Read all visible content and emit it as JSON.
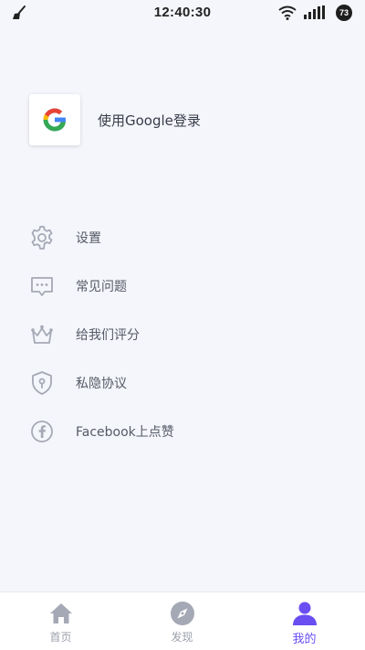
{
  "status_bar": {
    "time": "12:40:30",
    "battery_level": "73",
    "icons": [
      "cleaner-icon",
      "wifi-icon",
      "signal-icon",
      "battery-icon"
    ]
  },
  "login": {
    "label": "使用Google登录",
    "icon": "google-logo-icon"
  },
  "menu": {
    "items": [
      {
        "label": "设置",
        "icon": "gear-icon"
      },
      {
        "label": "常见问题",
        "icon": "chat-bubble-icon"
      },
      {
        "label": "给我们评分",
        "icon": "crown-icon"
      },
      {
        "label": "私隐协议",
        "icon": "shield-lock-icon"
      },
      {
        "label": "Facebook上点赞",
        "icon": "facebook-icon"
      }
    ]
  },
  "tab_bar": {
    "tabs": [
      {
        "label": "首页",
        "icon": "home-icon",
        "active": false
      },
      {
        "label": "发现",
        "icon": "compass-icon",
        "active": false
      },
      {
        "label": "我的",
        "icon": "user-icon",
        "active": true
      }
    ]
  },
  "colors": {
    "background": "#f5f6fb",
    "accent": "#6b4ef2",
    "icon_gray": "#a5a9b5",
    "text": "#555a66"
  }
}
